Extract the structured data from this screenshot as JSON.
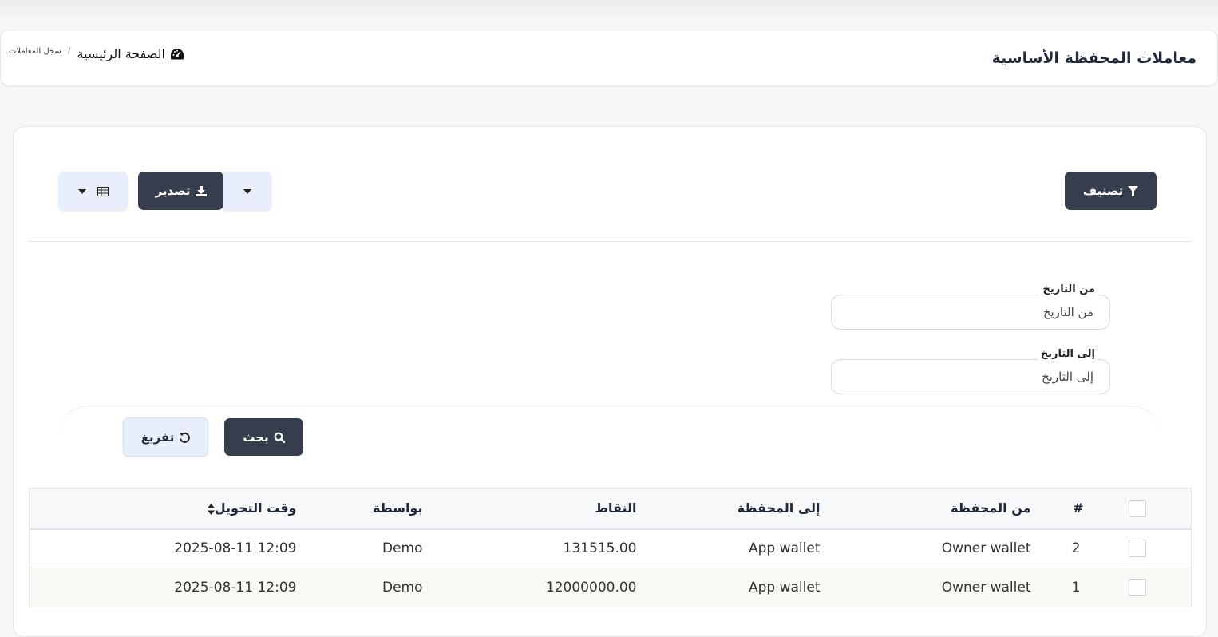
{
  "header": {
    "title": "معاملات المحفظة الأساسية",
    "breadcrumb": {
      "home": "الصفحة الرئيسية",
      "separator": "/",
      "current": "سجل المعاملات"
    }
  },
  "toolbar": {
    "filter_label": "تصنيف",
    "export_label": "تصدير"
  },
  "filters": {
    "from_date": {
      "label": "من التاريخ",
      "placeholder": "من التاريخ"
    },
    "to_date": {
      "label": "إلى التاريخ",
      "placeholder": "إلى التاريخ"
    },
    "search_label": "بحث",
    "reset_label": "تفريغ"
  },
  "table": {
    "headers": {
      "index": "#",
      "from_wallet": "من المحفظة",
      "to_wallet": "إلى المحفظة",
      "points": "النقاط",
      "by": "بواسطة",
      "transfer_time": "وقت التحويل"
    },
    "rows": [
      {
        "index": "2",
        "from_wallet": "Owner wallet",
        "to_wallet": "App wallet",
        "points": "131515.00",
        "by": "Demo",
        "transfer_time": "2025-08-11 12:09"
      },
      {
        "index": "1",
        "from_wallet": "Owner wallet",
        "to_wallet": "App wallet",
        "points": "12000000.00",
        "by": "Demo",
        "transfer_time": "2025-08-11 12:09"
      }
    ]
  },
  "colors": {
    "dark_button": "#363d4c",
    "light_button": "#e8eefb",
    "page_bg": "#f6f7f9"
  },
  "icons": {
    "breadcrumb_home": "dashboard-icon",
    "filter": "filter-icon",
    "export": "download-icon",
    "columns": "table-icon",
    "search": "search-icon",
    "reset": "undo-icon",
    "sort": "sort-icon"
  }
}
